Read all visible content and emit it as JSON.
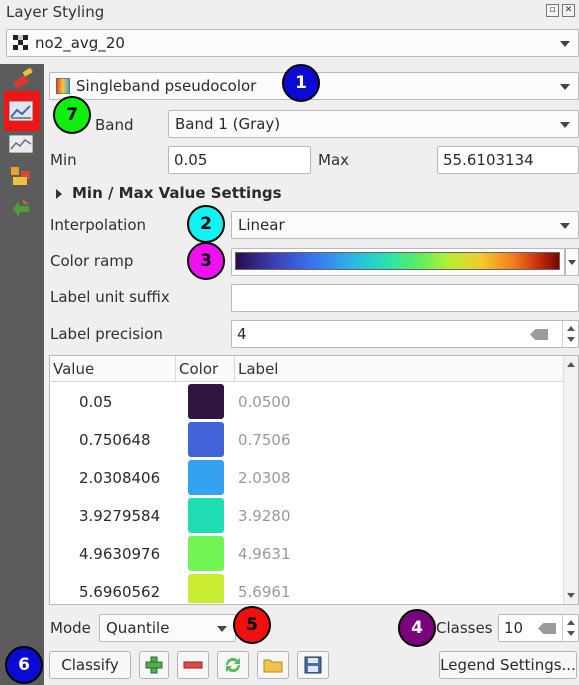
{
  "panel": {
    "title": "Layer Styling"
  },
  "layer_select": {
    "value": "no2_avg_20"
  },
  "renderer": {
    "value": "Singleband pseudocolor"
  },
  "band": {
    "label": "Band",
    "value": "Band 1 (Gray)"
  },
  "min": {
    "label": "Min",
    "value": "0.05"
  },
  "max": {
    "label": "Max",
    "value": "55.6103134"
  },
  "minmax_section": {
    "label": "Min / Max Value Settings"
  },
  "interpolation": {
    "label": "Interpolation",
    "value": "Linear"
  },
  "color_ramp": {
    "label": "Color ramp"
  },
  "label_unit_suffix": {
    "label": "Label unit suffix",
    "value": ""
  },
  "label_precision": {
    "label": "Label precision",
    "value": "4"
  },
  "table": {
    "headers": [
      "Value",
      "Color",
      "Label"
    ],
    "rows": [
      {
        "value": "0.05",
        "color": "#2e1640",
        "label": "0.0500"
      },
      {
        "value": "0.750648",
        "color": "#4363d8",
        "label": "0.7506"
      },
      {
        "value": "2.0308406",
        "color": "#35a2f0",
        "label": "2.0308"
      },
      {
        "value": "3.9279584",
        "color": "#1fdcb2",
        "label": "3.9280"
      },
      {
        "value": "4.9630976",
        "color": "#72f554",
        "label": "4.9631"
      },
      {
        "value": "5.6960562",
        "color": "#c9ec33",
        "label": "5.6961"
      }
    ]
  },
  "mode": {
    "label": "Mode",
    "value": "Quantile"
  },
  "classes": {
    "label": "Classes",
    "value": "10"
  },
  "buttons": {
    "classify": "Classify",
    "legend_settings": "Legend Settings..."
  },
  "badges": [
    "1",
    "2",
    "3",
    "4",
    "5",
    "6",
    "7"
  ],
  "badge_colors": {
    "1": "#0a0ad2",
    "2": "#11f3f3",
    "3": "#f00ff0",
    "4": "#7b007b",
    "5": "#f01010",
    "6": "#0a0ad2",
    "7": "#10f010"
  },
  "highlight_color": "#f01414"
}
